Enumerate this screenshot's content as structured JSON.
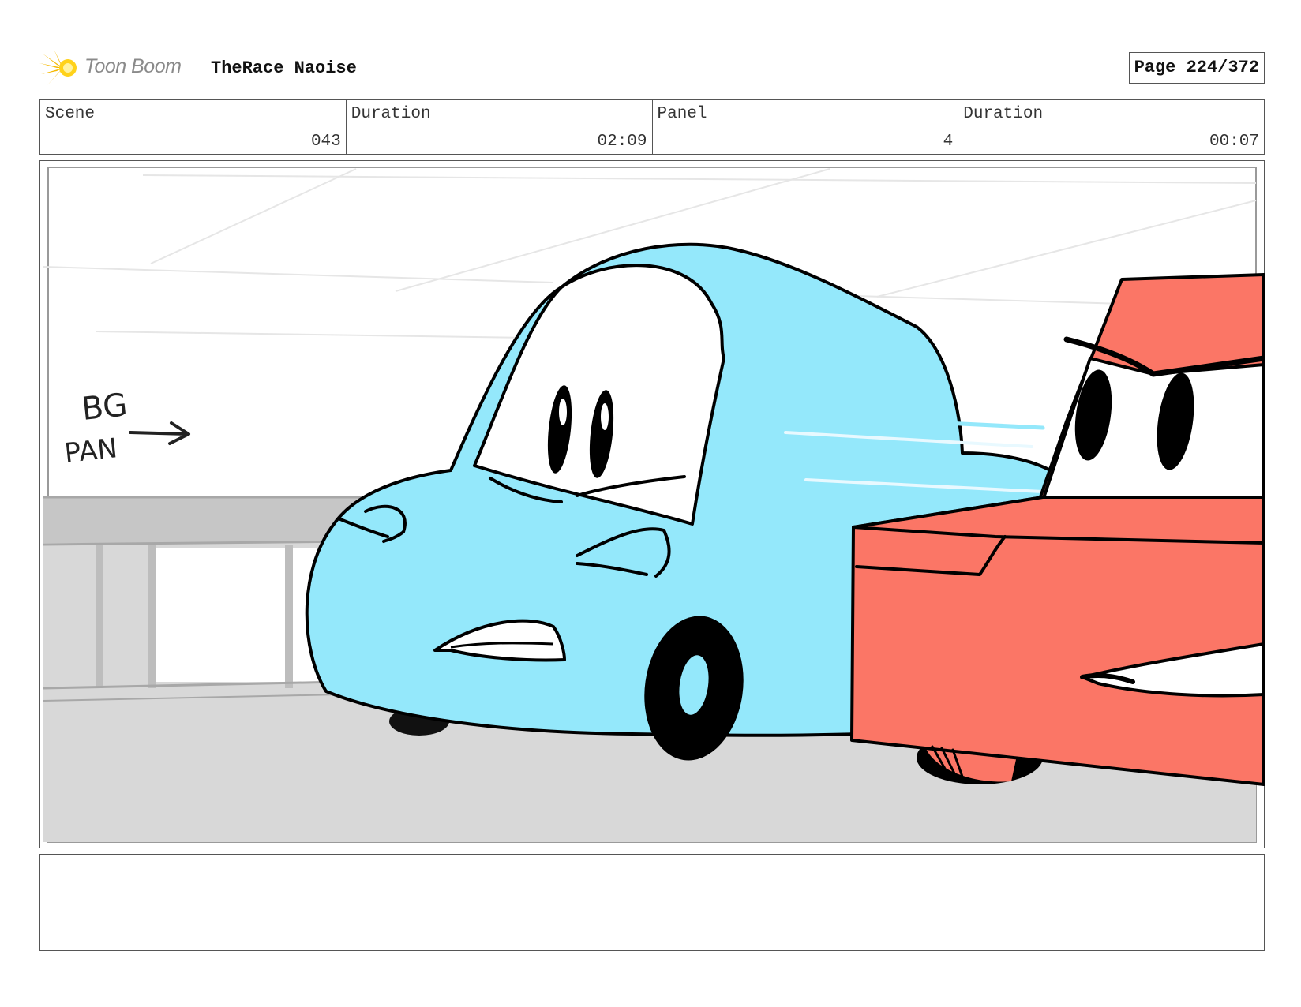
{
  "header": {
    "logo_text": "Toon Boom",
    "project_title": "TheRace Naoise",
    "page_label": "Page 224/372"
  },
  "info": [
    {
      "label": "Scene",
      "value": "043"
    },
    {
      "label": "Duration",
      "value": "02:09"
    },
    {
      "label": "Panel",
      "value": "4"
    },
    {
      "label": "Duration",
      "value": "00:07"
    }
  ],
  "panel": {
    "annotation_line1": "BG",
    "annotation_line2": "PAN",
    "colors": {
      "blue_car": "#94e8fb",
      "red_car": "#fb7666",
      "road": "#d8d8d8",
      "rail": "#b5b5b5",
      "outline": "#000000"
    }
  },
  "notes": {
    "text": ""
  }
}
